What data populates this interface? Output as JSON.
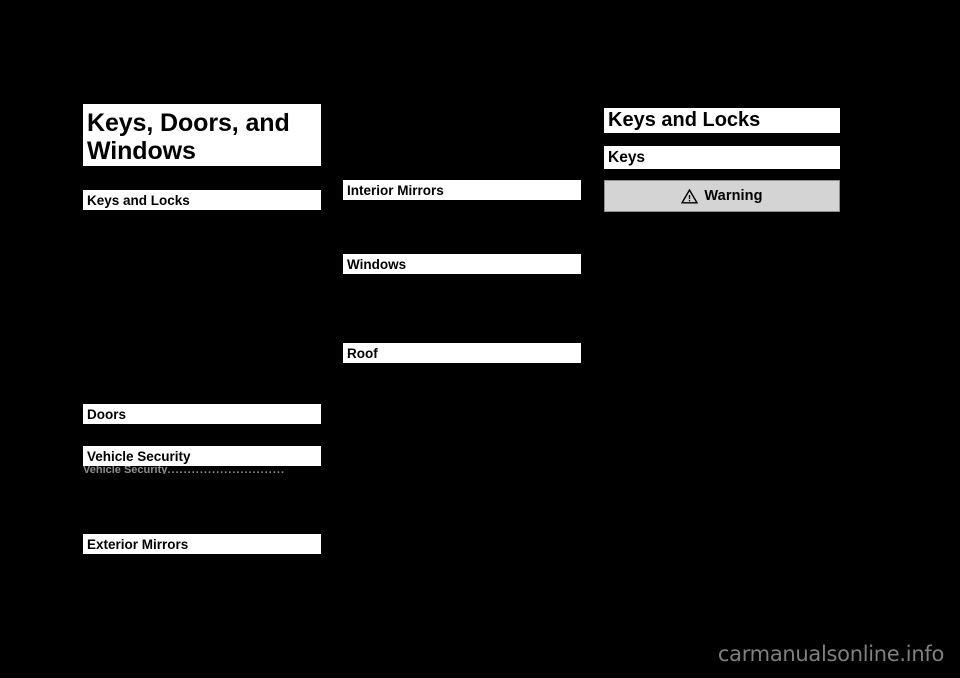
{
  "document": {
    "chapter_title_line1": "Keys, Doors, and",
    "chapter_title_line2": "Windows",
    "watermark": "carmanualsonline.info"
  },
  "toc": {
    "left_column": [
      {
        "label": "Keys and Locks"
      },
      {
        "label": "Doors"
      },
      {
        "label": "Vehicle Security"
      },
      {
        "label": "Exterior Mirrors"
      }
    ],
    "left_column_ghost_entry": "Vehicle Security",
    "left_column_ghost_dots": ".............................",
    "middle_column": [
      {
        "label": "Interior Mirrors"
      },
      {
        "label": "Windows"
      },
      {
        "label": "Roof"
      }
    ]
  },
  "content": {
    "section_title": "Keys and Locks",
    "subsection_title": "Keys",
    "warning": {
      "label": "Warning",
      "icon": "warning-triangle-icon"
    }
  },
  "colors": {
    "page_background": "#000000",
    "bar_background": "#ffffff",
    "text": "#000000",
    "warning_background": "#d4d4d4",
    "warning_border": "#8d8d8d",
    "watermark": "#7f7f7f"
  }
}
